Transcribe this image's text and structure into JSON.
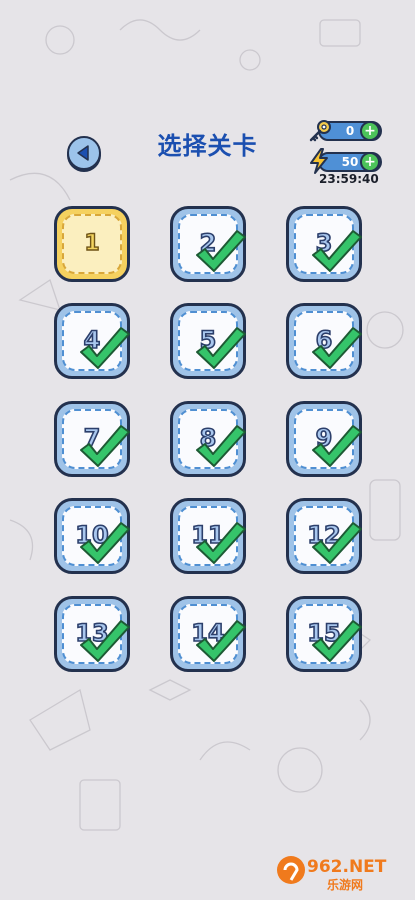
{
  "header": {
    "title": "选择关卡",
    "keys_count": "0",
    "energy_count": "50",
    "timer": "23:59:40",
    "plus": "+"
  },
  "levels": [
    {
      "num": "1",
      "status": "current"
    },
    {
      "num": "2",
      "status": "completed"
    },
    {
      "num": "3",
      "status": "completed"
    },
    {
      "num": "4",
      "status": "completed"
    },
    {
      "num": "5",
      "status": "completed"
    },
    {
      "num": "6",
      "status": "completed"
    },
    {
      "num": "7",
      "status": "completed"
    },
    {
      "num": "8",
      "status": "completed"
    },
    {
      "num": "9",
      "status": "completed"
    },
    {
      "num": "10",
      "status": "completed"
    },
    {
      "num": "11",
      "status": "completed"
    },
    {
      "num": "12",
      "status": "completed"
    },
    {
      "num": "13",
      "status": "completed"
    },
    {
      "num": "14",
      "status": "completed"
    },
    {
      "num": "15",
      "status": "completed"
    }
  ],
  "watermark": {
    "brand": "962.NET",
    "sub": "乐游网"
  },
  "colors": {
    "background": "#e6e4e8",
    "title": "#1b4fb0",
    "tile": "#9fc3e8",
    "tile_current": "#f5d15f",
    "check": "#35c46a",
    "pill": "#4f90d6",
    "plus": "#4cc35a"
  }
}
